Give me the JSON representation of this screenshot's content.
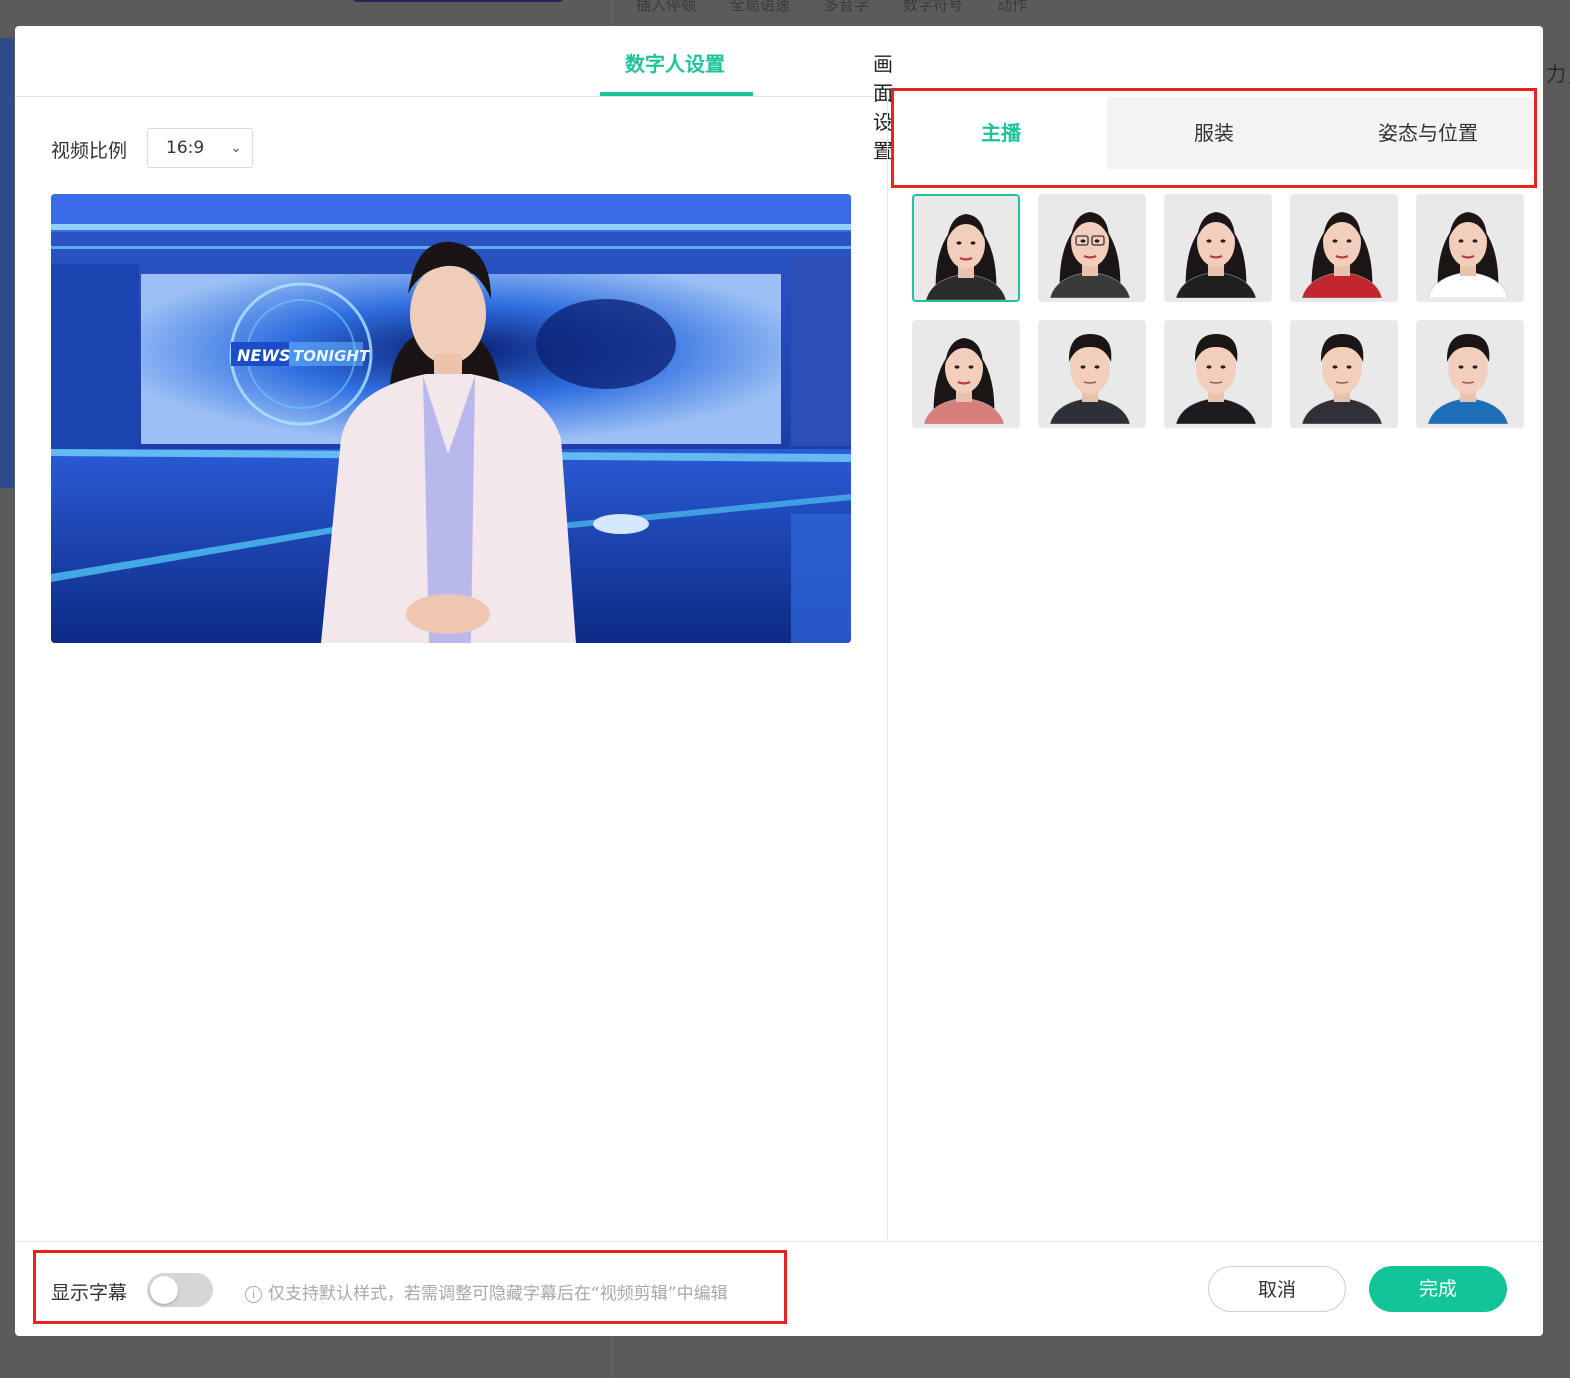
{
  "background": {
    "toolbar_items": [
      "插入停顿",
      "全局语速",
      "多音字",
      "数字符号",
      "动作"
    ],
    "right_fragment": "力，"
  },
  "tabs": {
    "digital_human": "数字人设置",
    "scene": "画面设置"
  },
  "ratio": {
    "label": "视频比例",
    "value": "16:9"
  },
  "preview": {
    "logo_news": "NEWS",
    "logo_tonight": "TONIGHT"
  },
  "subtabs": {
    "anchor": "主播",
    "costume": "服装",
    "pose": "姿态与位置"
  },
  "avatars": [
    {
      "gender": "female",
      "outfit": "#2b2b2b",
      "selected": true
    },
    {
      "gender": "female",
      "outfit": "#3a3a3a",
      "glasses": true
    },
    {
      "gender": "female",
      "outfit": "#1f1f1f"
    },
    {
      "gender": "female",
      "outfit": "#c0282d"
    },
    {
      "gender": "female",
      "outfit": "#ffffff"
    },
    {
      "gender": "female",
      "outfit": "#d67f7a"
    },
    {
      "gender": "male",
      "outfit": "#2d3036"
    },
    {
      "gender": "male",
      "outfit": "#1c1c20"
    },
    {
      "gender": "male",
      "outfit": "#303036"
    },
    {
      "gender": "male",
      "outfit": "#1f6fb8"
    }
  ],
  "footer": {
    "subtitle_label": "显示字幕",
    "subtitle_on": false,
    "hint": "仅支持默认样式，若需调整可隐藏字幕后在“视频剪辑”中编辑",
    "cancel": "取消",
    "done": "完成"
  },
  "colors": {
    "accent": "#1fc39a",
    "highlight_box": "#e8231f"
  }
}
